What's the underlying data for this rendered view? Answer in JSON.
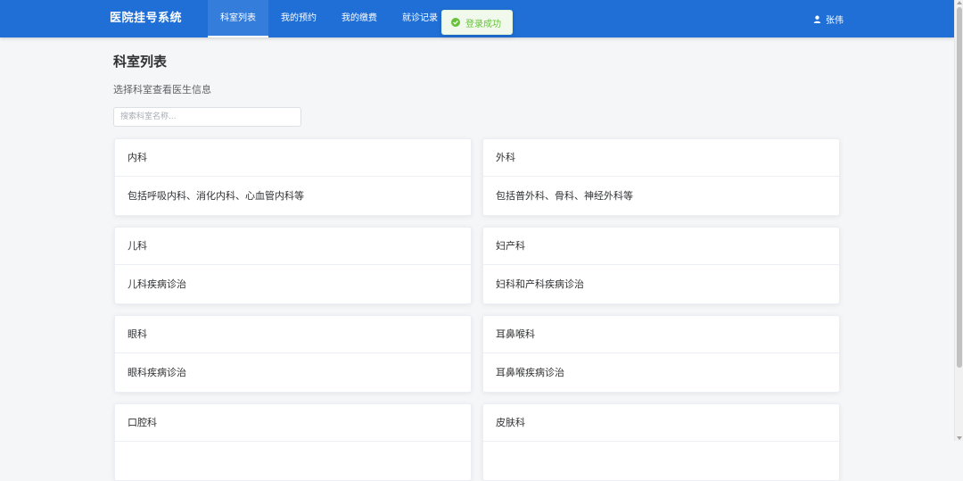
{
  "header": {
    "brand": "医院挂号系统",
    "nav": [
      {
        "label": "科室列表",
        "active": true
      },
      {
        "label": "我的预约",
        "active": false
      },
      {
        "label": "我的缴费",
        "active": false
      },
      {
        "label": "就诊记录",
        "active": false
      }
    ],
    "user": {
      "name": "张伟",
      "icon": "user-icon"
    },
    "color": "#1f6fd6"
  },
  "toast": {
    "message": "登录成功",
    "icon": "check-circle-icon",
    "color": "#67c23a"
  },
  "main": {
    "title": "科室列表",
    "subtitle": "选择科室查看医生信息",
    "search": {
      "placeholder": "搜索科室名称...",
      "value": ""
    },
    "departments": [
      {
        "name": "内科",
        "description": "包括呼吸内科、消化内科、心血管内科等"
      },
      {
        "name": "外科",
        "description": "包括普外科、骨科、神经外科等"
      },
      {
        "name": "儿科",
        "description": "儿科疾病诊治"
      },
      {
        "name": "妇产科",
        "description": "妇科和产科疾病诊治"
      },
      {
        "name": "眼科",
        "description": "眼科疾病诊治"
      },
      {
        "name": "耳鼻喉科",
        "description": "耳鼻喉疾病诊治"
      },
      {
        "name": "口腔科",
        "description": ""
      },
      {
        "name": "皮肤科",
        "description": ""
      }
    ]
  }
}
